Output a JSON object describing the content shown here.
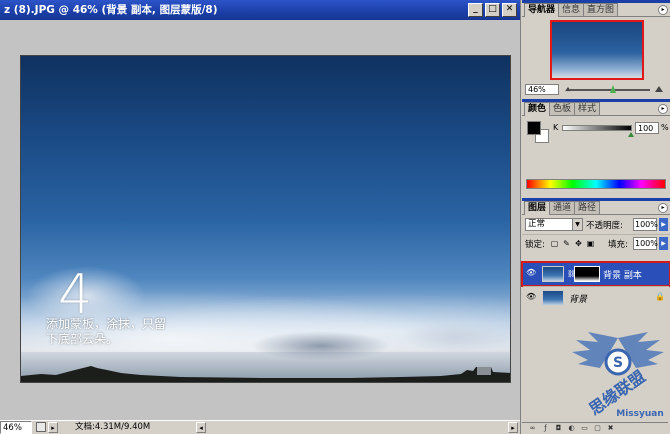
{
  "document": {
    "title": "z (8).JPG @ 46% (背景 副本, 图层蒙版/8)",
    "overlay_number": "4",
    "overlay_text": "添加蒙板，涂抹，只留下底部云朵。",
    "status": {
      "zoom": "46%",
      "info": "文档:4.31M/9.40M"
    }
  },
  "navigator": {
    "tabs": [
      "导航器",
      "信息",
      "直方图"
    ],
    "zoom": "46%"
  },
  "color": {
    "tabs": [
      "颜色",
      "色板",
      "样式"
    ],
    "channel_label": "K",
    "value": "100",
    "unit": "%"
  },
  "layers": {
    "tabs": [
      "图层",
      "通道",
      "路径"
    ],
    "blend_mode": "正常",
    "opacity_label": "不透明度:",
    "opacity": "100%",
    "lock_label": "锁定:",
    "fill_label": "填充:",
    "fill": "100%",
    "items": [
      {
        "name": "背景 副本",
        "selected": true
      },
      {
        "name": "背景",
        "selected": false,
        "locked": true
      }
    ]
  },
  "watermark": {
    "text": "思缘联盟",
    "logo_letter": "S",
    "sub": "Missyuan"
  }
}
